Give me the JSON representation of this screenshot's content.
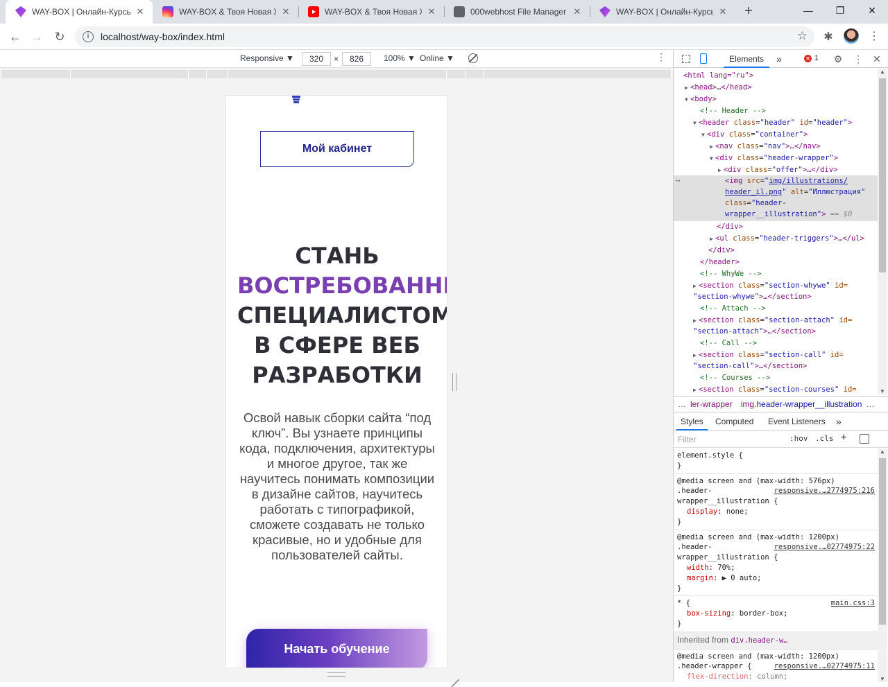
{
  "browser": {
    "tabs": [
      {
        "title": "WAY-BOX | Онлайн-Курсы",
        "icon": "waybox-icon",
        "active": true
      },
      {
        "title": "WAY-BOX & Твоя Новая Ж",
        "icon": "instagram-icon",
        "active": false
      },
      {
        "title": "WAY-BOX & Твоя Новая Ж",
        "icon": "youtube-icon",
        "active": false
      },
      {
        "title": "000webhost File Manager",
        "icon": "globe-icon",
        "active": false
      },
      {
        "title": "WAY-BOX | Онлайн-Курсы",
        "icon": "waybox-icon",
        "active": false
      }
    ],
    "new_tab_label": "+",
    "url": "localhost/way-box/index.html"
  },
  "device_toolbar": {
    "mode": "Responsive ▼",
    "width": "320",
    "times": "×",
    "height": "826",
    "zoom": "100% ▼",
    "network": "Online ▼"
  },
  "page": {
    "cabinet_button": "Мой кабинет",
    "title_line1": "СТАНЬ",
    "title_line2": "ВОСТРЕБОВАННЫМ",
    "title_line3": "СПЕЦИАЛИСТОМ",
    "title_line4": "В СФЕРЕ ВЕБ",
    "title_line5": "РАЗРАБОТКИ",
    "description": "Освой навык сборки сайта “под ключ”. Вы узнаете принципы кода, подключения, архитектуры и многое другое, так же научитесь понимать композиции в дизайне сайтов, научитесь работать с типографикой, сможете создавать не только красивые, но и удобные для пользователей сайты.",
    "start_button": "Начать обучение",
    "colors": {
      "accent": "#7a3fb0",
      "title": "#2f2f37",
      "button_start": "#2f24a8",
      "button_end": "#c29ae0"
    }
  },
  "devtools": {
    "tabs": {
      "elements": "Elements",
      "more": "»"
    },
    "error_count": "1",
    "dom": {
      "l1": "<html lang=\"ru\">",
      "l2a": "<head>",
      "l2b": "…",
      "l2c": "</head>",
      "l3": "<body>",
      "c_header": "<!-- Header -->",
      "header_tag": "<header",
      "header_attr1": "class",
      "header_val1": "\"header\"",
      "header_attr2": "id",
      "header_val2": "\"header\"",
      "container_tag": "<div",
      "container_attr": "class",
      "container_val": "\"container\"",
      "nav_tag": "<nav",
      "nav_attr": "class",
      "nav_val": "\"nav\"",
      "nav_rest": ">…</nav>",
      "hw_tag": "<div",
      "hw_attr": "class",
      "hw_val": "\"header-wrapper\"",
      "offer_tag": "<div",
      "offer_attr": "class",
      "offer_val": "\"offer\"",
      "offer_rest": ">…</div>",
      "img_tag": "<img",
      "img_src_attr": "src",
      "img_src_1": "img/illustrations/",
      "img_src_2": "header_il.png",
      "img_alt_attr": "alt",
      "img_alt_val": "\"Иллюстрация\"",
      "img_class_attr": "class",
      "img_class_1": "\"header-",
      "img_class_2": "wrapper__illustration\"",
      "img_eq": "== $0",
      "div_close": "</div>",
      "ul_tag": "<ul",
      "ul_attr": "class",
      "ul_val": "\"header-triggers\"",
      "ul_rest": ">…</ul>",
      "div_close2": "</div>",
      "header_close": "</header>",
      "c_whywe": "<!-- WhyWe -->",
      "sec1_tag": "<section",
      "sec1_attr": "class",
      "sec1_val": "\"section-whywe\"",
      "sec1_id": "id=",
      "sec1_id_val": "\"section-whywe\"",
      "sec1_rest": ">…</section>",
      "c_attach": "<!-- Attach -->",
      "sec2_tag": "<section",
      "sec2_attr": "class",
      "sec2_val": "\"section-attach\"",
      "sec2_id": "id=",
      "sec2_id_val": "\"section-attach\"",
      "sec2_rest": ">…</section>",
      "c_call": "<!-- Call -->",
      "sec3_tag": "<section",
      "sec3_attr": "class",
      "sec3_val": "\"section-call\"",
      "sec3_id": "id=",
      "sec3_id_val": "\"section-call\"",
      "sec3_rest": ">…</section>",
      "c_courses": "<!-- Courses -->",
      "sec4_tag": "<section",
      "sec4_attr": "class",
      "sec4_val": "\"section-courses\"",
      "sec4_id": "id="
    },
    "breadcrumbs": {
      "ellipsis": "…",
      "c1": "ler-wrapper",
      "c2_tag": "img",
      "c2_class": ".header-wrapper__illustration",
      "more": "…"
    },
    "pane_tabs": {
      "styles": "Styles",
      "computed": "Computed",
      "listeners": "Event Listeners",
      "more": "»"
    },
    "filter": {
      "placeholder": "Filter",
      "hov": ":hov",
      "cls": ".cls",
      "plus": "+"
    },
    "styles": {
      "r1_sel": "element.style {",
      "r1_close": "}",
      "r2_media": "@media screen and (max-width: 576px)",
      "r2_sel1": ".header-",
      "r2_src": "responsive.…2774975:216",
      "r2_sel2": "wrapper__illustration {",
      "r2_p1n": "display",
      "r2_p1v": "none;",
      "r2_close": "}",
      "r3_media": "@media screen and (max-width: 1200px)",
      "r3_sel1": ".header-",
      "r3_src": "responsive.…02774975:22",
      "r3_sel2": "wrapper__illustration {",
      "r3_p1n": "width",
      "r3_p1v": "70%;",
      "r3_p2n": "margin",
      "r3_p2v": "▶ 0 auto;",
      "r3_close": "}",
      "r4_sel": "* {",
      "r4_src": "main.css:3",
      "r4_p1n": "box-sizing",
      "r4_p1v": "border-box;",
      "r4_close": "}",
      "inherited_label": "Inherited from",
      "inherited_el": "div.header-w…",
      "r5_media": "@media screen and (max-width: 1200px)",
      "r5_sel": ".header-wrapper {",
      "r5_src": "responsive.…02774975:11",
      "r5_p1n": "flex-direction",
      "r5_p1v": "column;"
    }
  }
}
